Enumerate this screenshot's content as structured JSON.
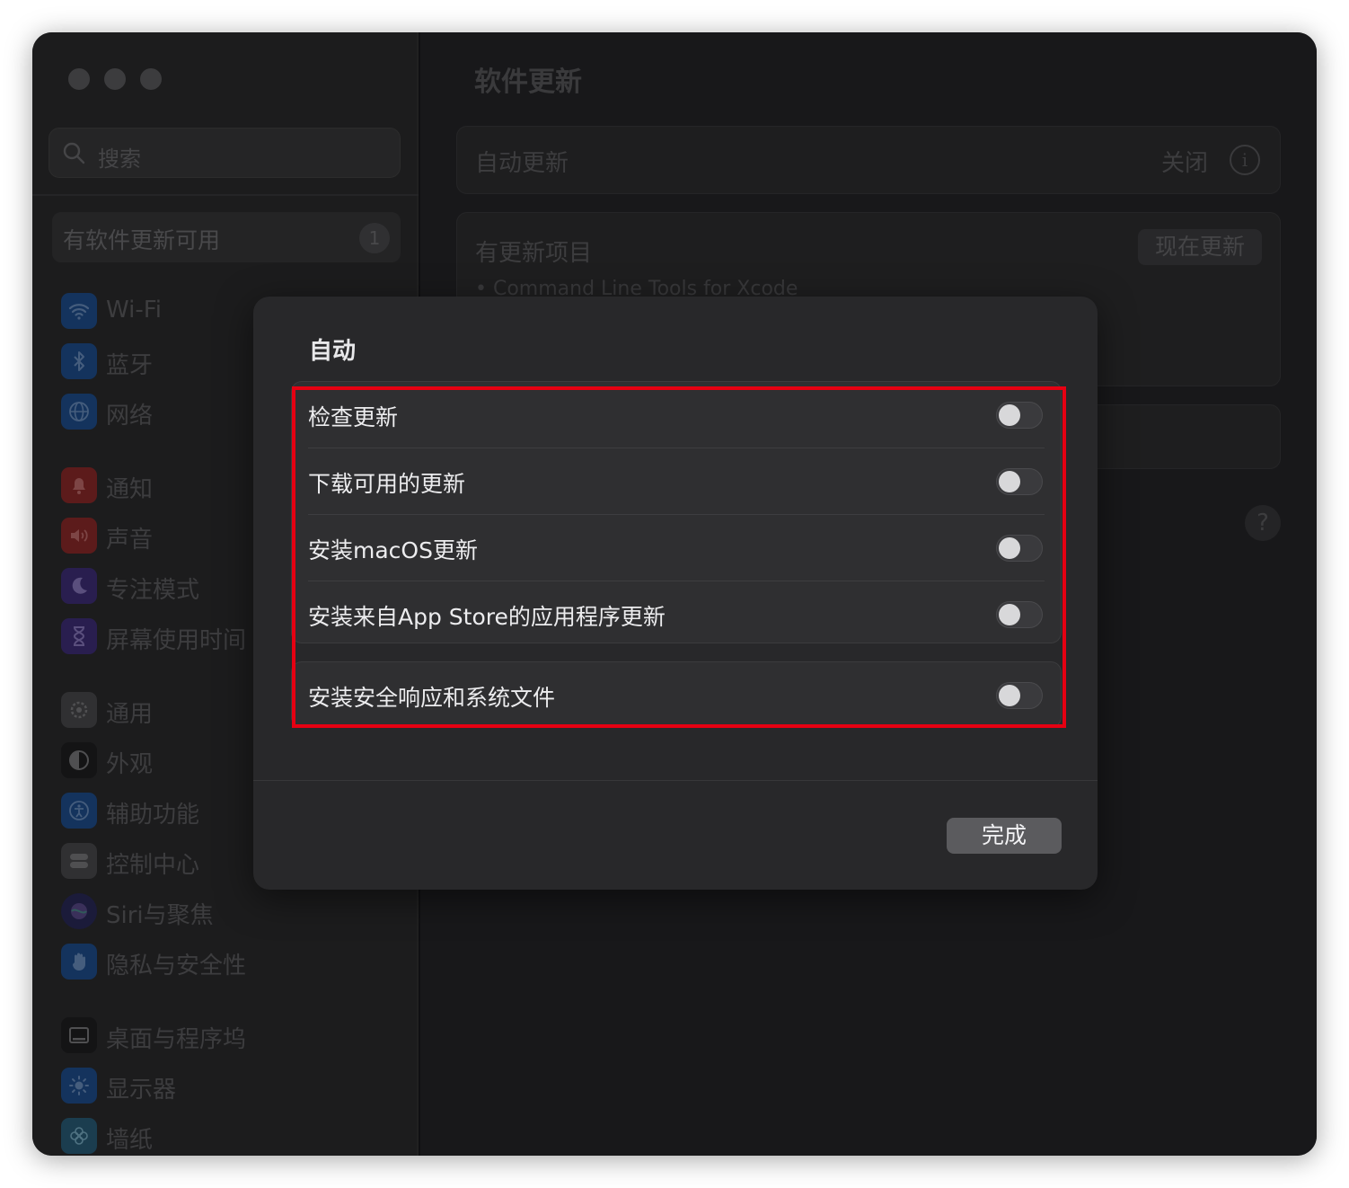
{
  "sidebar": {
    "search_placeholder": "搜索",
    "update_banner": {
      "label": "有软件更新可用",
      "badge": "1"
    },
    "items": [
      {
        "label": "Wi-Fi",
        "icon": "wifi-icon",
        "color": "#1f4f8f"
      },
      {
        "label": "蓝牙",
        "icon": "bluetooth-icon",
        "color": "#1f4f8f"
      },
      {
        "label": "网络",
        "icon": "globe-icon",
        "color": "#1f4f8f"
      },
      {
        "label": "通知",
        "icon": "bell-icon",
        "color": "#8e2a2a"
      },
      {
        "label": "声音",
        "icon": "speaker-icon",
        "color": "#8e2a2a"
      },
      {
        "label": "专注模式",
        "icon": "moon-icon",
        "color": "#3f2f7a"
      },
      {
        "label": "屏幕使用时间",
        "icon": "hourglass-icon",
        "color": "#3f2f7a"
      },
      {
        "label": "通用",
        "icon": "gear-icon",
        "color": "#4a4a4d"
      },
      {
        "label": "外观",
        "icon": "appearance-icon",
        "color": "#1f1f21"
      },
      {
        "label": "辅助功能",
        "icon": "accessibility-icon",
        "color": "#1f4f8f"
      },
      {
        "label": "控制中心",
        "icon": "control-center-icon",
        "color": "#4a4a4d"
      },
      {
        "label": "Siri与聚焦",
        "icon": "siri-icon",
        "color": "#2a2a5a"
      },
      {
        "label": "隐私与安全性",
        "icon": "hand-icon",
        "color": "#1f4f8f"
      },
      {
        "label": "桌面与程序坞",
        "icon": "dock-icon",
        "color": "#1f1f21"
      },
      {
        "label": "显示器",
        "icon": "sun-icon",
        "color": "#1f4f8f"
      },
      {
        "label": "墙纸",
        "icon": "wallpaper-icon",
        "color": "#2a5f7a"
      }
    ]
  },
  "content": {
    "title": "软件更新",
    "auto_update": {
      "label": "自动更新",
      "value": "关闭"
    },
    "updates": {
      "label": "有更新项目",
      "button": "现在更新",
      "item": "• Command Line Tools for Xcode"
    },
    "help": "?"
  },
  "sheet": {
    "title": "自动",
    "options": [
      {
        "label": "检查更新",
        "on": false
      },
      {
        "label": "下载可用的更新",
        "on": false
      },
      {
        "label": "安装macOS更新",
        "on": false
      },
      {
        "label": "安装来自App Store的应用程序更新",
        "on": false
      }
    ],
    "security_option": {
      "label": "安装安全响应和系统文件",
      "on": false
    },
    "done_label": "完成"
  },
  "highlight_color": "#e60012"
}
